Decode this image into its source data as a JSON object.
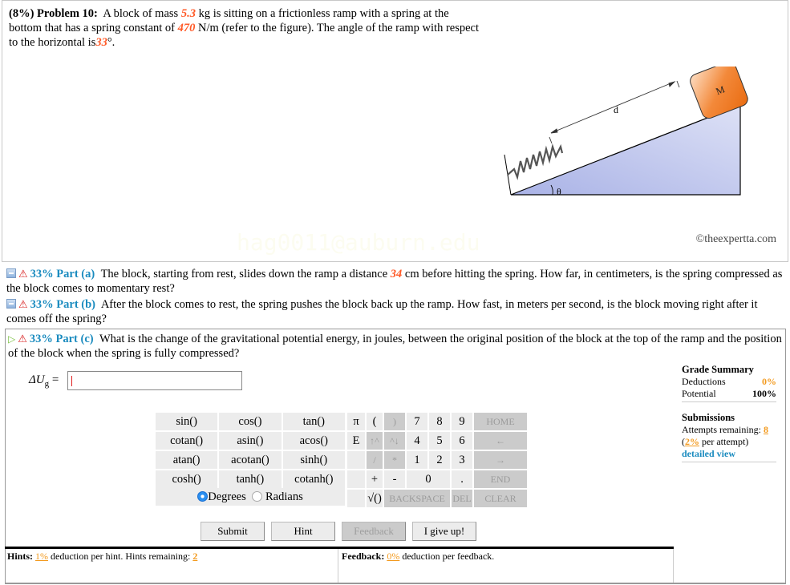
{
  "problem": {
    "weight": "(8%)",
    "title": "Problem 10:",
    "text_1": "A block of mass",
    "mass": "5.3",
    "text_2": "kg is sitting on a frictionless ramp with a spring at the bottom that has a spring constant of",
    "spring_constant": "470",
    "text_3": "N/m (refer to the figure). The angle of the ramp with respect to the horizontal is",
    "angle": "33",
    "text_4": "°."
  },
  "figure": {
    "block_label": "M",
    "distance_label": "d",
    "angle_label": "θ",
    "copyright": "©theexpertta.com",
    "watermark": "hag0011@auburn.edu",
    "colors": {
      "block": "#f07a22",
      "ramp": "#c6cdf0"
    }
  },
  "parts": [
    {
      "percent": "33%",
      "label": "Part (a)",
      "text_1": "The block, starting from rest, slides down the ramp a distance",
      "value": "34",
      "text_2": "cm before hitting the spring. How far, in centimeters, is the spring compressed as the block comes to momentary rest?"
    },
    {
      "percent": "33%",
      "label": "Part (b)",
      "text": "After the block comes to rest, the spring pushes the block back up the ramp. How fast, in meters per second, is the block moving right after it comes off the spring?"
    },
    {
      "percent": "33%",
      "label": "Part (c)",
      "text": "What is the change of the gravitational potential energy, in joules, between the original position of the block at the top of the ramp and the position of the block when the spring is fully compressed?"
    }
  ],
  "answer": {
    "symbol": "ΔU",
    "subscript": "g",
    "equals": "=",
    "value": ""
  },
  "grade_summary": {
    "title": "Grade Summary",
    "deductions_label": "Deductions",
    "deductions_value": "0%",
    "potential_label": "Potential",
    "potential_value": "100%"
  },
  "submissions": {
    "title": "Submissions",
    "attempts_label": "Attempts remaining:",
    "attempts_value": "8",
    "per_attempt_pct": "2%",
    "per_attempt_text": "per attempt)",
    "open_paren": "(",
    "detailed_view": "detailed view"
  },
  "keypad": {
    "functions": [
      [
        "sin()",
        "cos()",
        "tan()"
      ],
      [
        "cotan()",
        "asin()",
        "acos()"
      ],
      [
        "atan()",
        "acotan()",
        "sinh()"
      ],
      [
        "cosh()",
        "tanh()",
        "cotanh()"
      ]
    ],
    "degrees": "Degrees",
    "radians": "Radians",
    "pi": "π",
    "e": "E",
    "open_paren": "(",
    "close_paren": ")",
    "up": "↑^",
    "down": "^↓",
    "divide": "/",
    "multiply": "*",
    "plus": "+",
    "minus": "-",
    "sqrt": "√()",
    "digits": [
      "7",
      "8",
      "9",
      "4",
      "5",
      "6",
      "1",
      "2",
      "3",
      "0"
    ],
    "dot": ".",
    "home": "HOME",
    "left": "←",
    "right": "→",
    "end": "END",
    "backspace": "BACKSPACE",
    "del": "DEL",
    "clear": "CLEAR"
  },
  "buttons": {
    "submit": "Submit",
    "hint": "Hint",
    "feedback": "Feedback",
    "give_up": "I give up!"
  },
  "hints": {
    "label": "Hints:",
    "pct": "1%",
    "text": "deduction per hint. Hints remaining:",
    "remaining": "2"
  },
  "feedback": {
    "label": "Feedback:",
    "pct": "0%",
    "text": "deduction per feedback."
  }
}
